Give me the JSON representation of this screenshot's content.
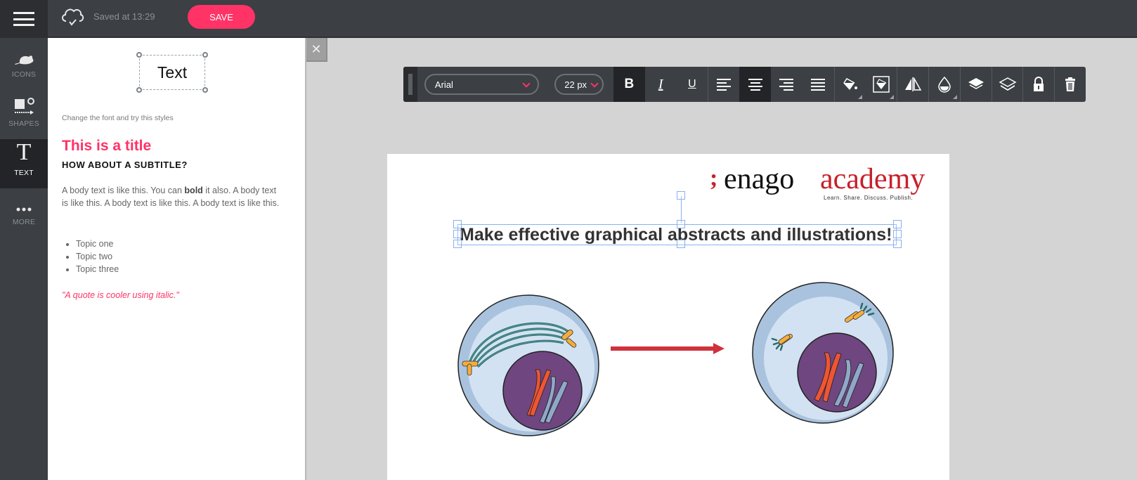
{
  "topbar": {
    "menu_icon": "hamburger-menu-icon",
    "cloud_icon": "cloud-check-icon",
    "saved_status": "Saved at 13:29",
    "save_label": "SAVE",
    "accent_color": "#ff3366"
  },
  "leftnav": {
    "items": [
      {
        "label": "ICONS",
        "icon": "mouse-icon",
        "active": false
      },
      {
        "label": "SHAPES",
        "icon": "shapes-icon",
        "active": false
      },
      {
        "label": "TEXT",
        "icon": "text-t-icon",
        "active": true
      },
      {
        "label": "MORE",
        "icon": "more-dots-icon",
        "active": false
      }
    ]
  },
  "panel": {
    "sample_text": "Text",
    "hint": "Change the font and try this styles",
    "title": "This is a title",
    "subtitle": "HOW ABOUT A SUBTITLE?",
    "body_pre": "A body text is like this. You can ",
    "body_bold": "bold",
    "body_post": " it also. A body text is like this. A body text is like this. A body text is like this.",
    "list": [
      "Topic one",
      "Topic two",
      "Topic three"
    ],
    "quote": "\"A quote is cooler using italic.\"",
    "close_icon": "close-x-icon"
  },
  "toolbar": {
    "font_family": "Arial",
    "font_size": "22 px",
    "buttons": [
      {
        "name": "bold",
        "icon": "bold-icon",
        "active": true
      },
      {
        "name": "italic",
        "icon": "italic-icon",
        "active": false
      },
      {
        "name": "underline",
        "icon": "underline-icon",
        "active": false
      },
      {
        "name": "align-left",
        "icon": "align-left-icon",
        "active": false
      },
      {
        "name": "align-center",
        "icon": "align-center-icon",
        "active": true
      },
      {
        "name": "align-right",
        "icon": "align-right-icon",
        "active": false
      },
      {
        "name": "justify",
        "icon": "align-justify-icon",
        "active": false
      },
      {
        "name": "fill-color",
        "icon": "paint-bucket-icon",
        "active": false
      },
      {
        "name": "background-color",
        "icon": "background-fill-icon",
        "active": false
      },
      {
        "name": "flip",
        "icon": "flip-horizontal-icon",
        "active": false
      },
      {
        "name": "opacity",
        "icon": "opacity-drop-icon",
        "active": false
      },
      {
        "name": "bring-forward",
        "icon": "layer-up-icon",
        "active": false
      },
      {
        "name": "send-backward",
        "icon": "layer-down-icon",
        "active": false
      },
      {
        "name": "lock",
        "icon": "lock-icon",
        "active": false
      },
      {
        "name": "delete",
        "icon": "trash-icon",
        "active": false
      }
    ]
  },
  "canvas": {
    "logo": {
      "mark": ";",
      "brand": "enago",
      "brand_suffix": "academy",
      "tagline": "Learn. Share. Discuss. Publish.",
      "brand_color": "#c8202a"
    },
    "headline": "Make effective graphical abstracts and illustrations!",
    "illustrations": [
      "cell-with-spindle-fibers",
      "red-arrow",
      "cell-with-centrosomes"
    ]
  }
}
